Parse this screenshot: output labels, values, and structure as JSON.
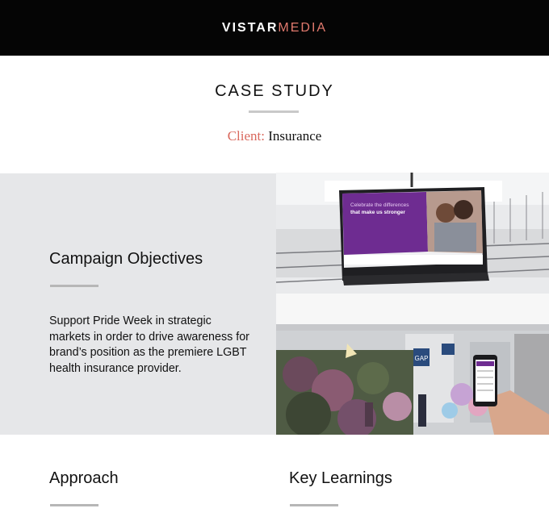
{
  "header": {
    "logo_part1": "VISTAR",
    "logo_part2": "MEDIA"
  },
  "page": {
    "title": "CASE STUDY",
    "client_label": "Client:",
    "client_value": "Insurance"
  },
  "objectives": {
    "title": "Campaign Objectives",
    "text": "Support Pride Week in strategic markets in order to drive awareness for brand’s position as the premiere LGBT health insurance provider."
  },
  "photo": {
    "screen_headline_1": "Celebrate the differences",
    "screen_headline_2": "that make us stronger",
    "store_sign": "GAP"
  },
  "sections": {
    "approach": "Approach",
    "key_learnings": "Key Learnings"
  },
  "colors": {
    "accent": "#e27a6e",
    "panel": "#e6e7e9",
    "header": "#050505"
  }
}
